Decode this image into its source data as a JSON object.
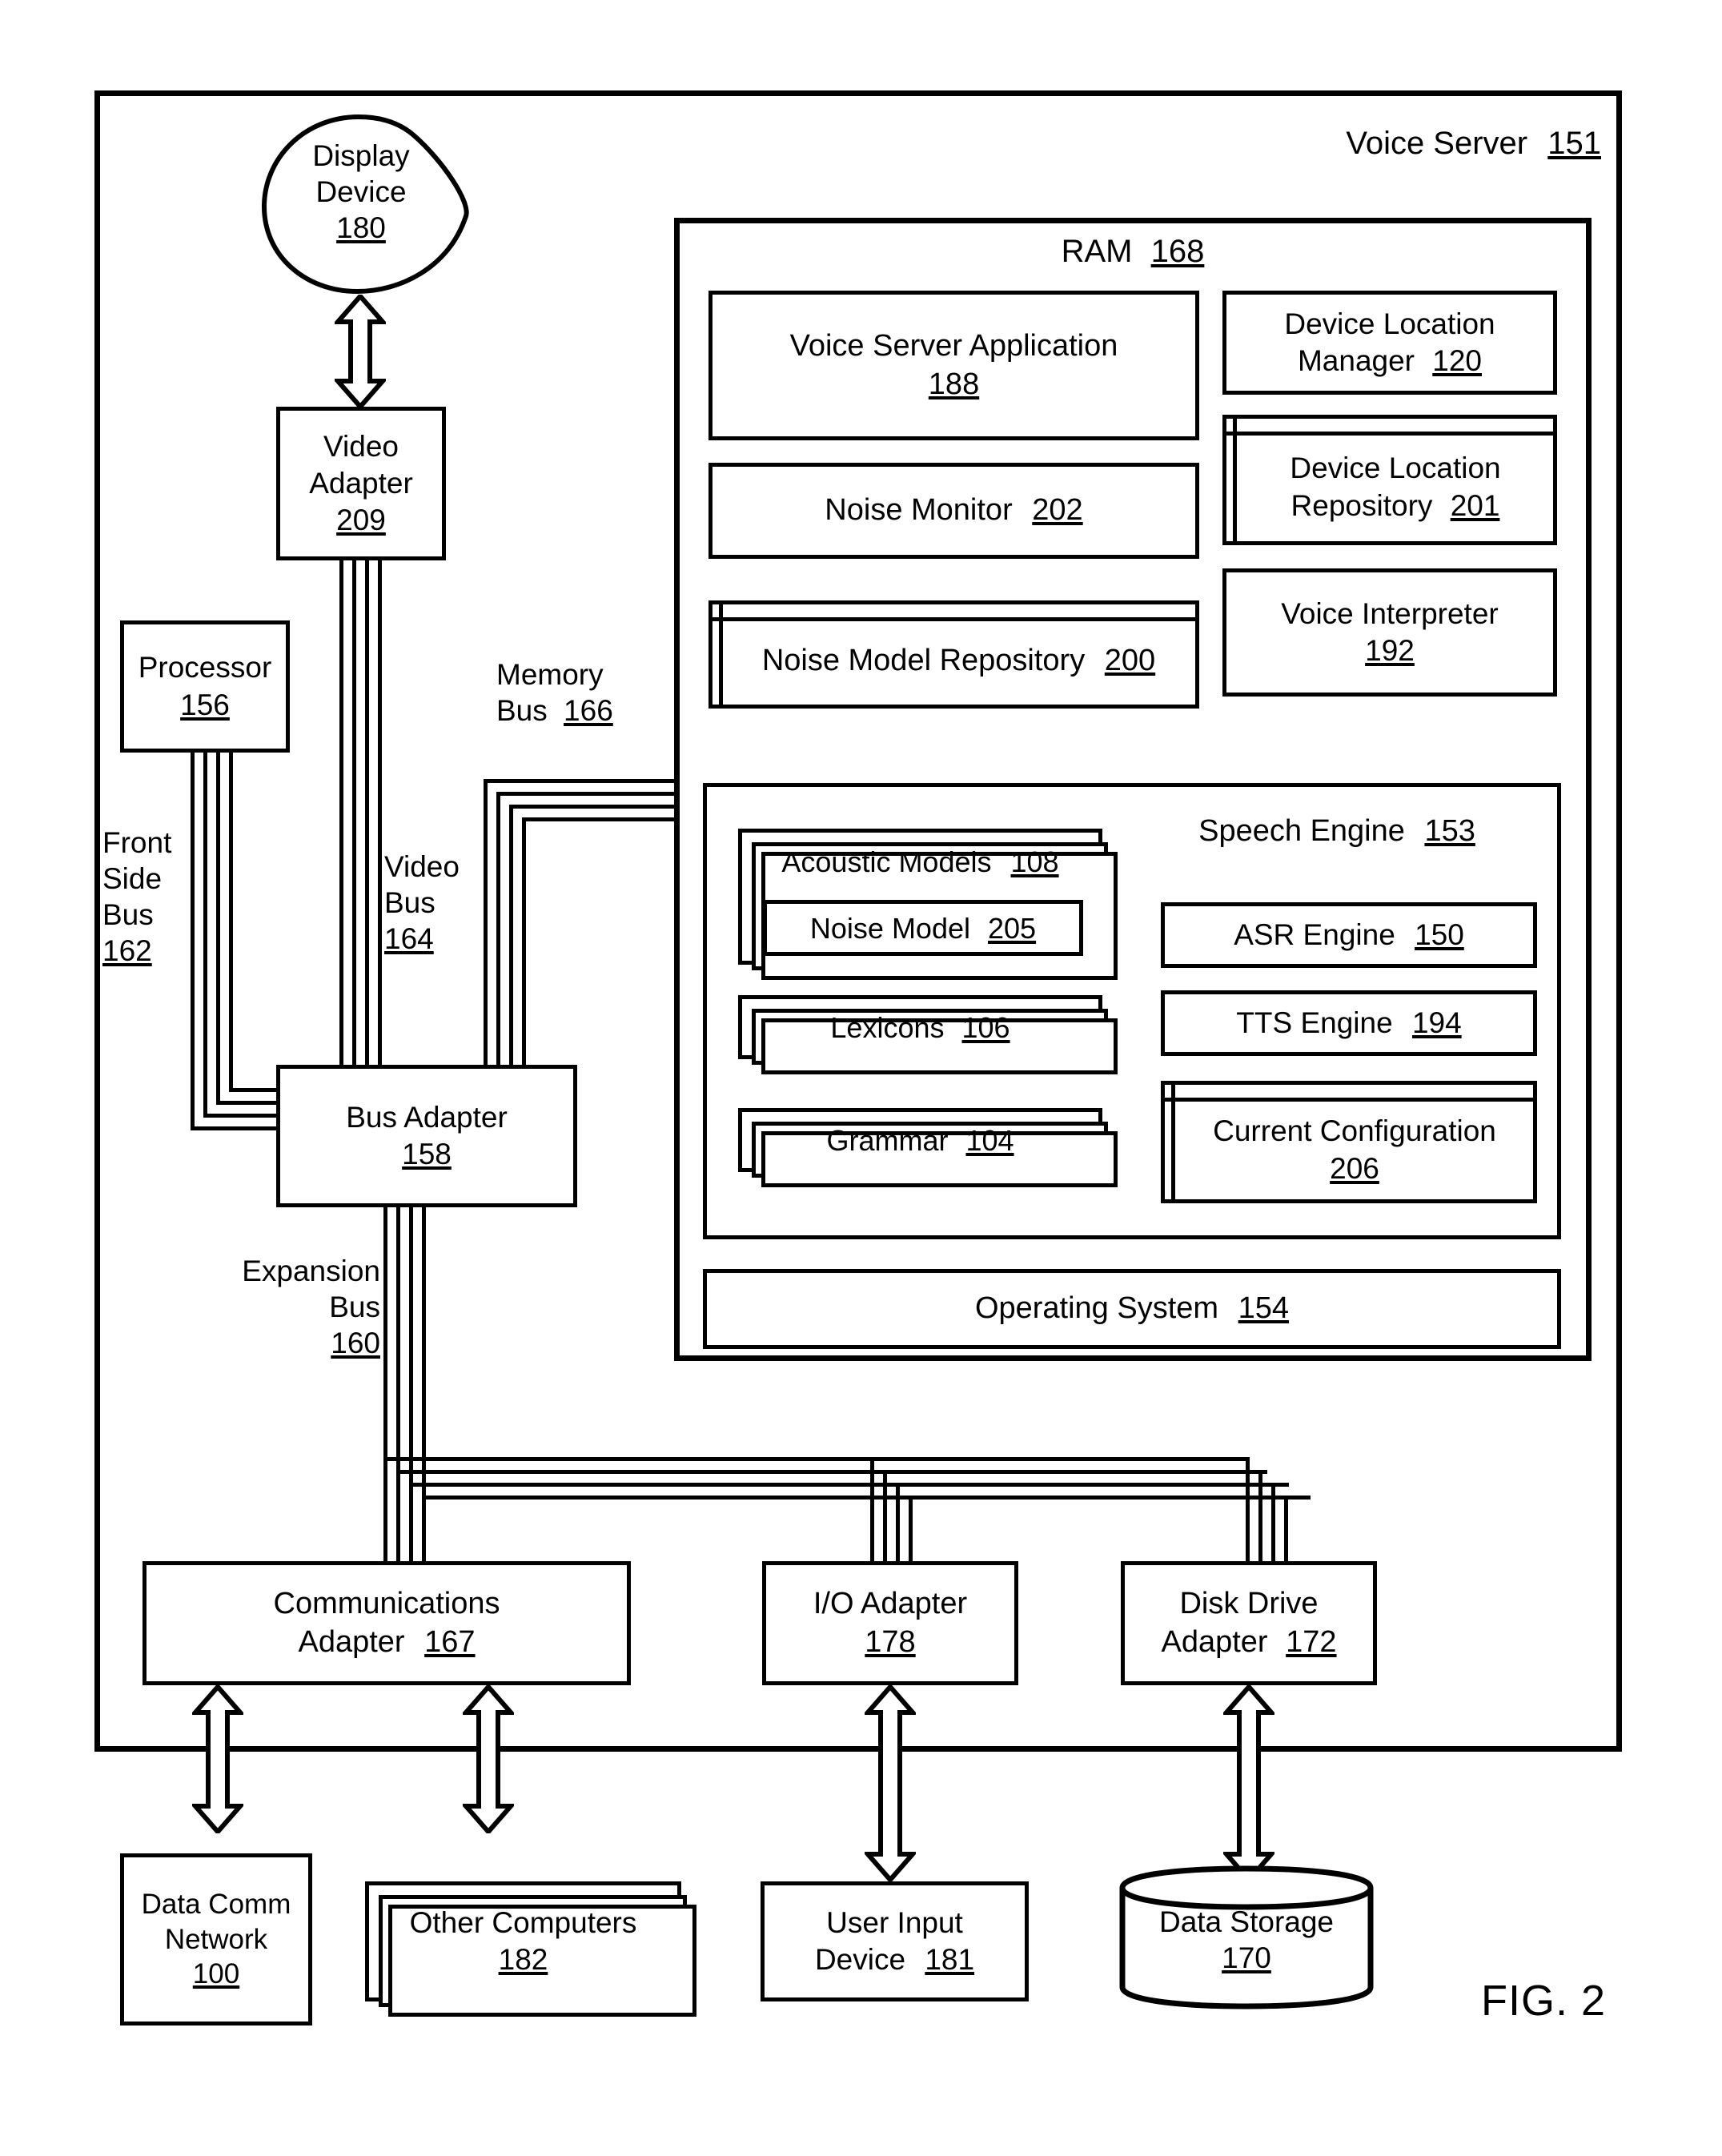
{
  "figure": {
    "caption": "FIG. 2"
  },
  "outer": {
    "title": "Voice Server",
    "ref": "151"
  },
  "display_device": {
    "label_line1": "Display",
    "label_line2": "Device",
    "ref": "180"
  },
  "video_adapter": {
    "label_line1": "Video",
    "label_line2": "Adapter",
    "ref": "209"
  },
  "processor": {
    "label": "Processor",
    "ref": "156"
  },
  "bus_adapter": {
    "label": "Bus Adapter",
    "ref": "158"
  },
  "buses": {
    "front_side": {
      "line1": "Front",
      "line2": "Side",
      "line3": "Bus",
      "ref": "162"
    },
    "video": {
      "line1": "Video",
      "line2": "Bus",
      "ref": "164"
    },
    "memory": {
      "line1": "Memory",
      "line2": "Bus",
      "ref": "166"
    },
    "expansion": {
      "line1": "Expansion",
      "line2": "Bus",
      "ref": "160"
    }
  },
  "ram": {
    "title": "RAM",
    "ref": "168",
    "items": [
      {
        "name": "voice-server-application",
        "label": "Voice Server Application",
        "ref": "188",
        "style": "plain"
      },
      {
        "name": "device-location-manager",
        "label": "Device Location Manager",
        "ref": "120",
        "style": "plain"
      },
      {
        "name": "noise-monitor",
        "label": "Noise Monitor",
        "ref": "202",
        "style": "plain"
      },
      {
        "name": "device-location-repository",
        "label": "Device Location Repository",
        "ref": "201",
        "style": "repository"
      },
      {
        "name": "noise-model-repository",
        "label": "Noise Model Repository",
        "ref": "200",
        "style": "repository"
      },
      {
        "name": "voice-interpreter",
        "label": "Voice Interpreter",
        "ref": "192",
        "style": "plain"
      }
    ],
    "operating_system": {
      "label": "Operating System",
      "ref": "154"
    }
  },
  "speech_engine": {
    "title": "Speech Engine",
    "ref": "153",
    "acoustic_models": {
      "label": "Acoustic Models",
      "ref": "108",
      "style": "stacked"
    },
    "noise_model": {
      "label": "Noise Model",
      "ref": "205",
      "style": "plain"
    },
    "lexicons": {
      "label": "Lexicons",
      "ref": "106",
      "style": "stacked"
    },
    "grammar": {
      "label": "Grammar",
      "ref": "104",
      "style": "stacked"
    },
    "asr_engine": {
      "label": "ASR Engine",
      "ref": "150",
      "style": "plain"
    },
    "tts_engine": {
      "label": "TTS Engine",
      "ref": "194",
      "style": "plain"
    },
    "current_configuration": {
      "label": "Current Configuration",
      "ref": "206",
      "style": "repository"
    }
  },
  "adapters": {
    "communications": {
      "line1": "Communications",
      "line2": "Adapter",
      "ref": "167"
    },
    "io": {
      "line1": "I/O Adapter",
      "line2": "",
      "ref": "178"
    },
    "disk_drive": {
      "line1": "Disk Drive",
      "line2": "Adapter",
      "ref": "172"
    }
  },
  "peripherals": {
    "data_comm_network": {
      "line1": "Data Comm",
      "line2": "Network",
      "ref": "100"
    },
    "other_computers": {
      "line1": "Other Computers",
      "ref": "182",
      "style": "stacked"
    },
    "user_input_device": {
      "line1": "User Input",
      "line2": "Device",
      "ref": "181"
    },
    "data_storage": {
      "line1": "Data Storage",
      "ref": "170",
      "style": "cylinder"
    }
  }
}
